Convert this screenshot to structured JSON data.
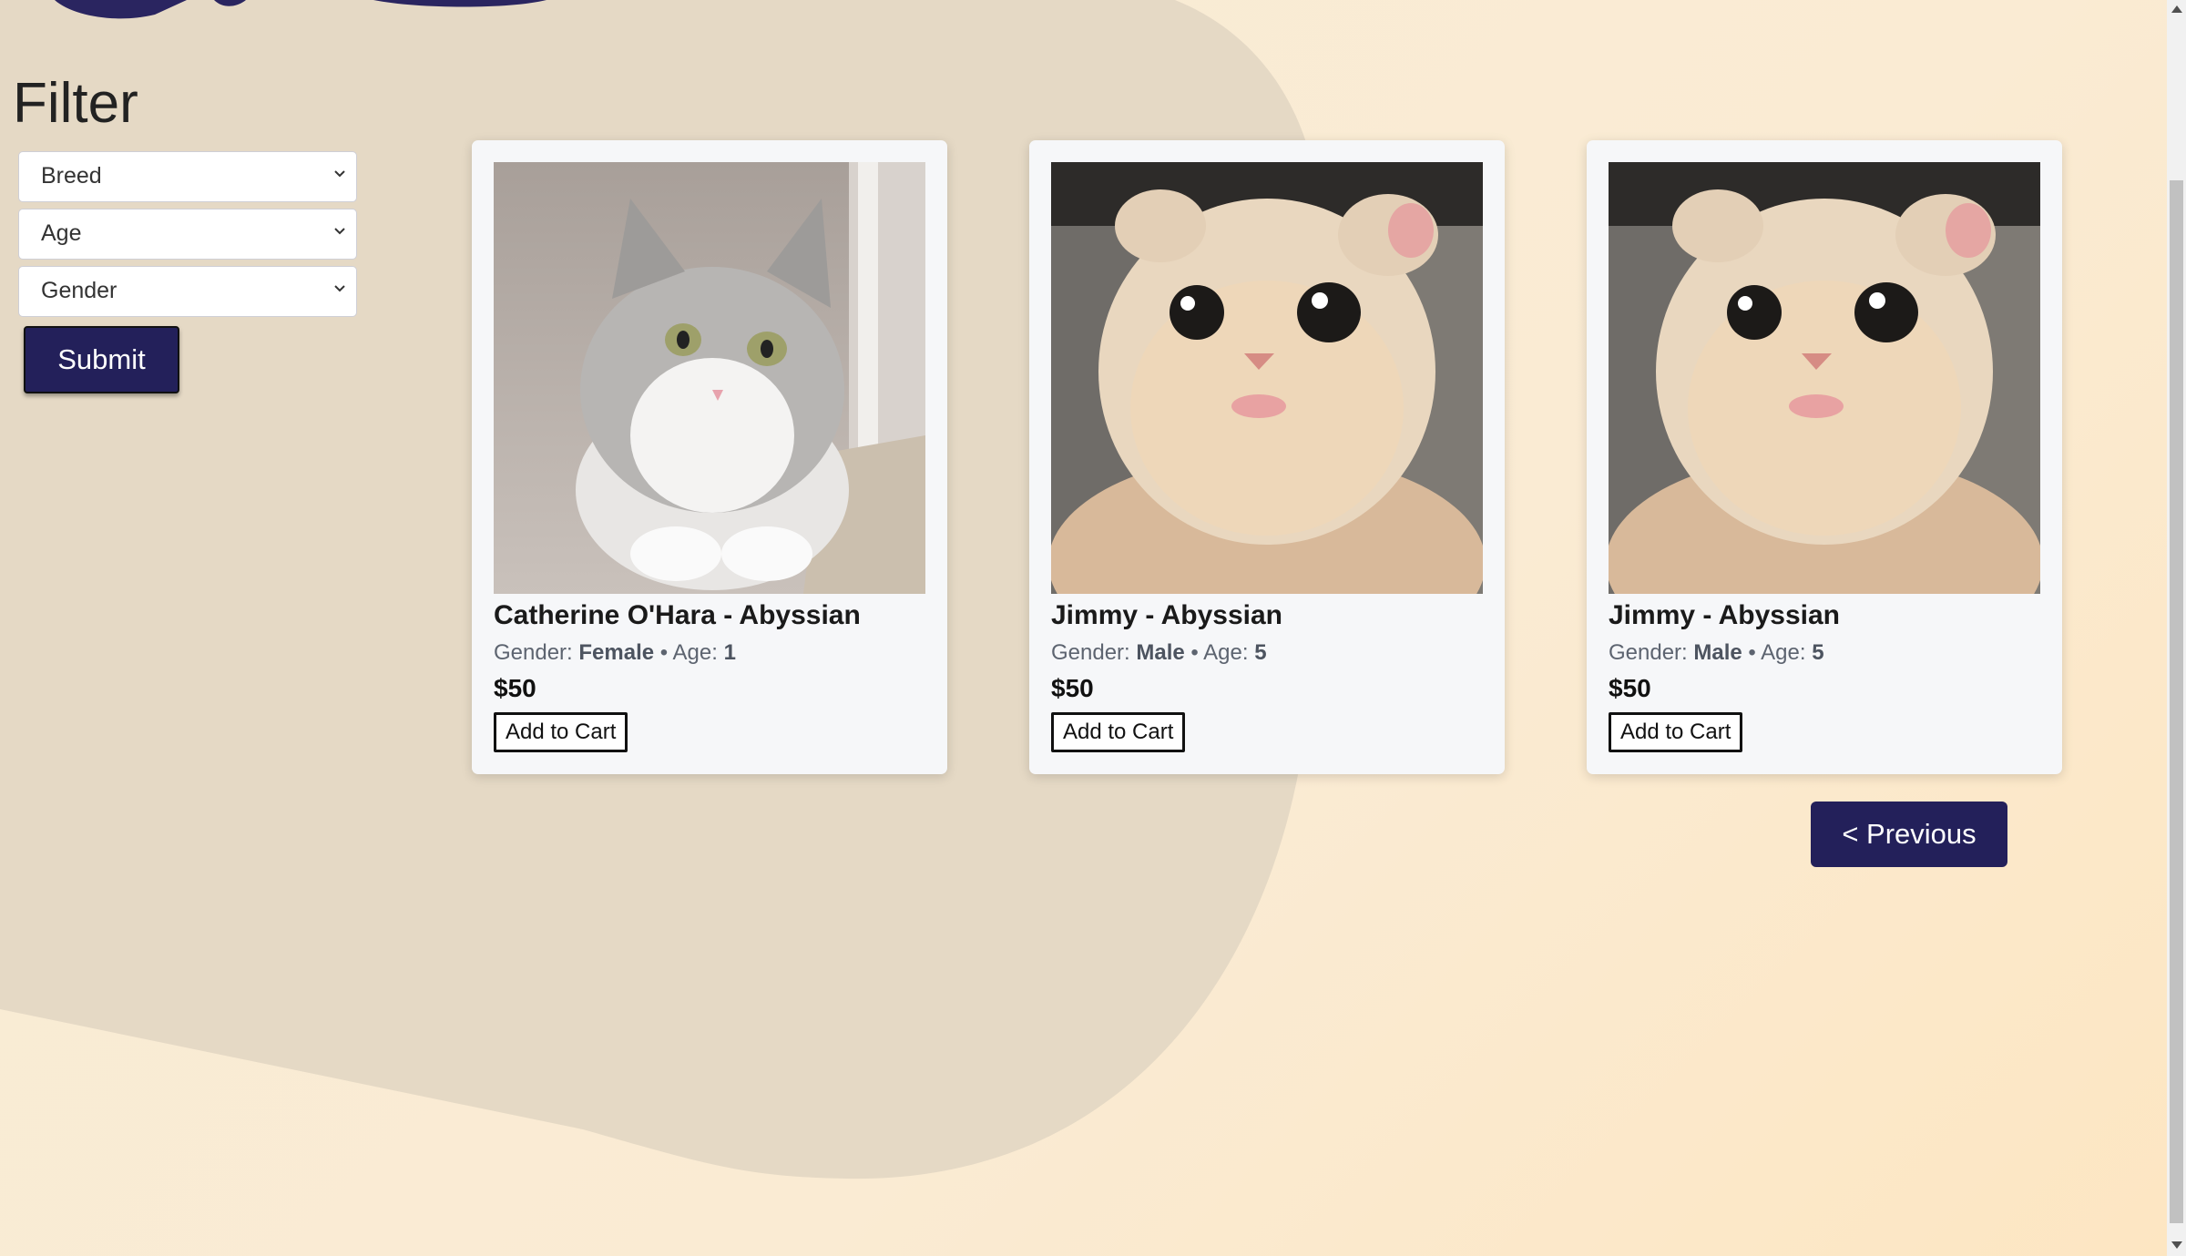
{
  "theme": {
    "accent": "#23205a",
    "blob": "#e5d9c5",
    "page_bg": "#f8ecd6",
    "card_bg": "#f6f7f9"
  },
  "filter": {
    "title": "Filter",
    "selects": [
      {
        "value": "Breed"
      },
      {
        "value": "Age"
      },
      {
        "value": "Gender"
      }
    ],
    "submit_label": "Submit"
  },
  "products": [
    {
      "name": "Catherine O'Hara - Abyssian",
      "gender_label": "Gender:",
      "gender": "Female",
      "separator": "•",
      "age_label": "Age:",
      "age": "1",
      "price": "$50",
      "cart_label": "Add to Cart",
      "image": "grey-white-kitten"
    },
    {
      "name": "Jimmy - Abyssian",
      "gender_label": "Gender:",
      "gender": "Male",
      "separator": "•",
      "age_label": "Age:",
      "age": "5",
      "price": "$50",
      "cart_label": "Add to Cart",
      "image": "orange-cat-in-hat"
    },
    {
      "name": "Jimmy - Abyssian",
      "gender_label": "Gender:",
      "gender": "Male",
      "separator": "•",
      "age_label": "Age:",
      "age": "5",
      "price": "$50",
      "cart_label": "Add to Cart",
      "image": "orange-cat-in-hat"
    }
  ],
  "pagination": {
    "previous_label": "< Previous"
  }
}
